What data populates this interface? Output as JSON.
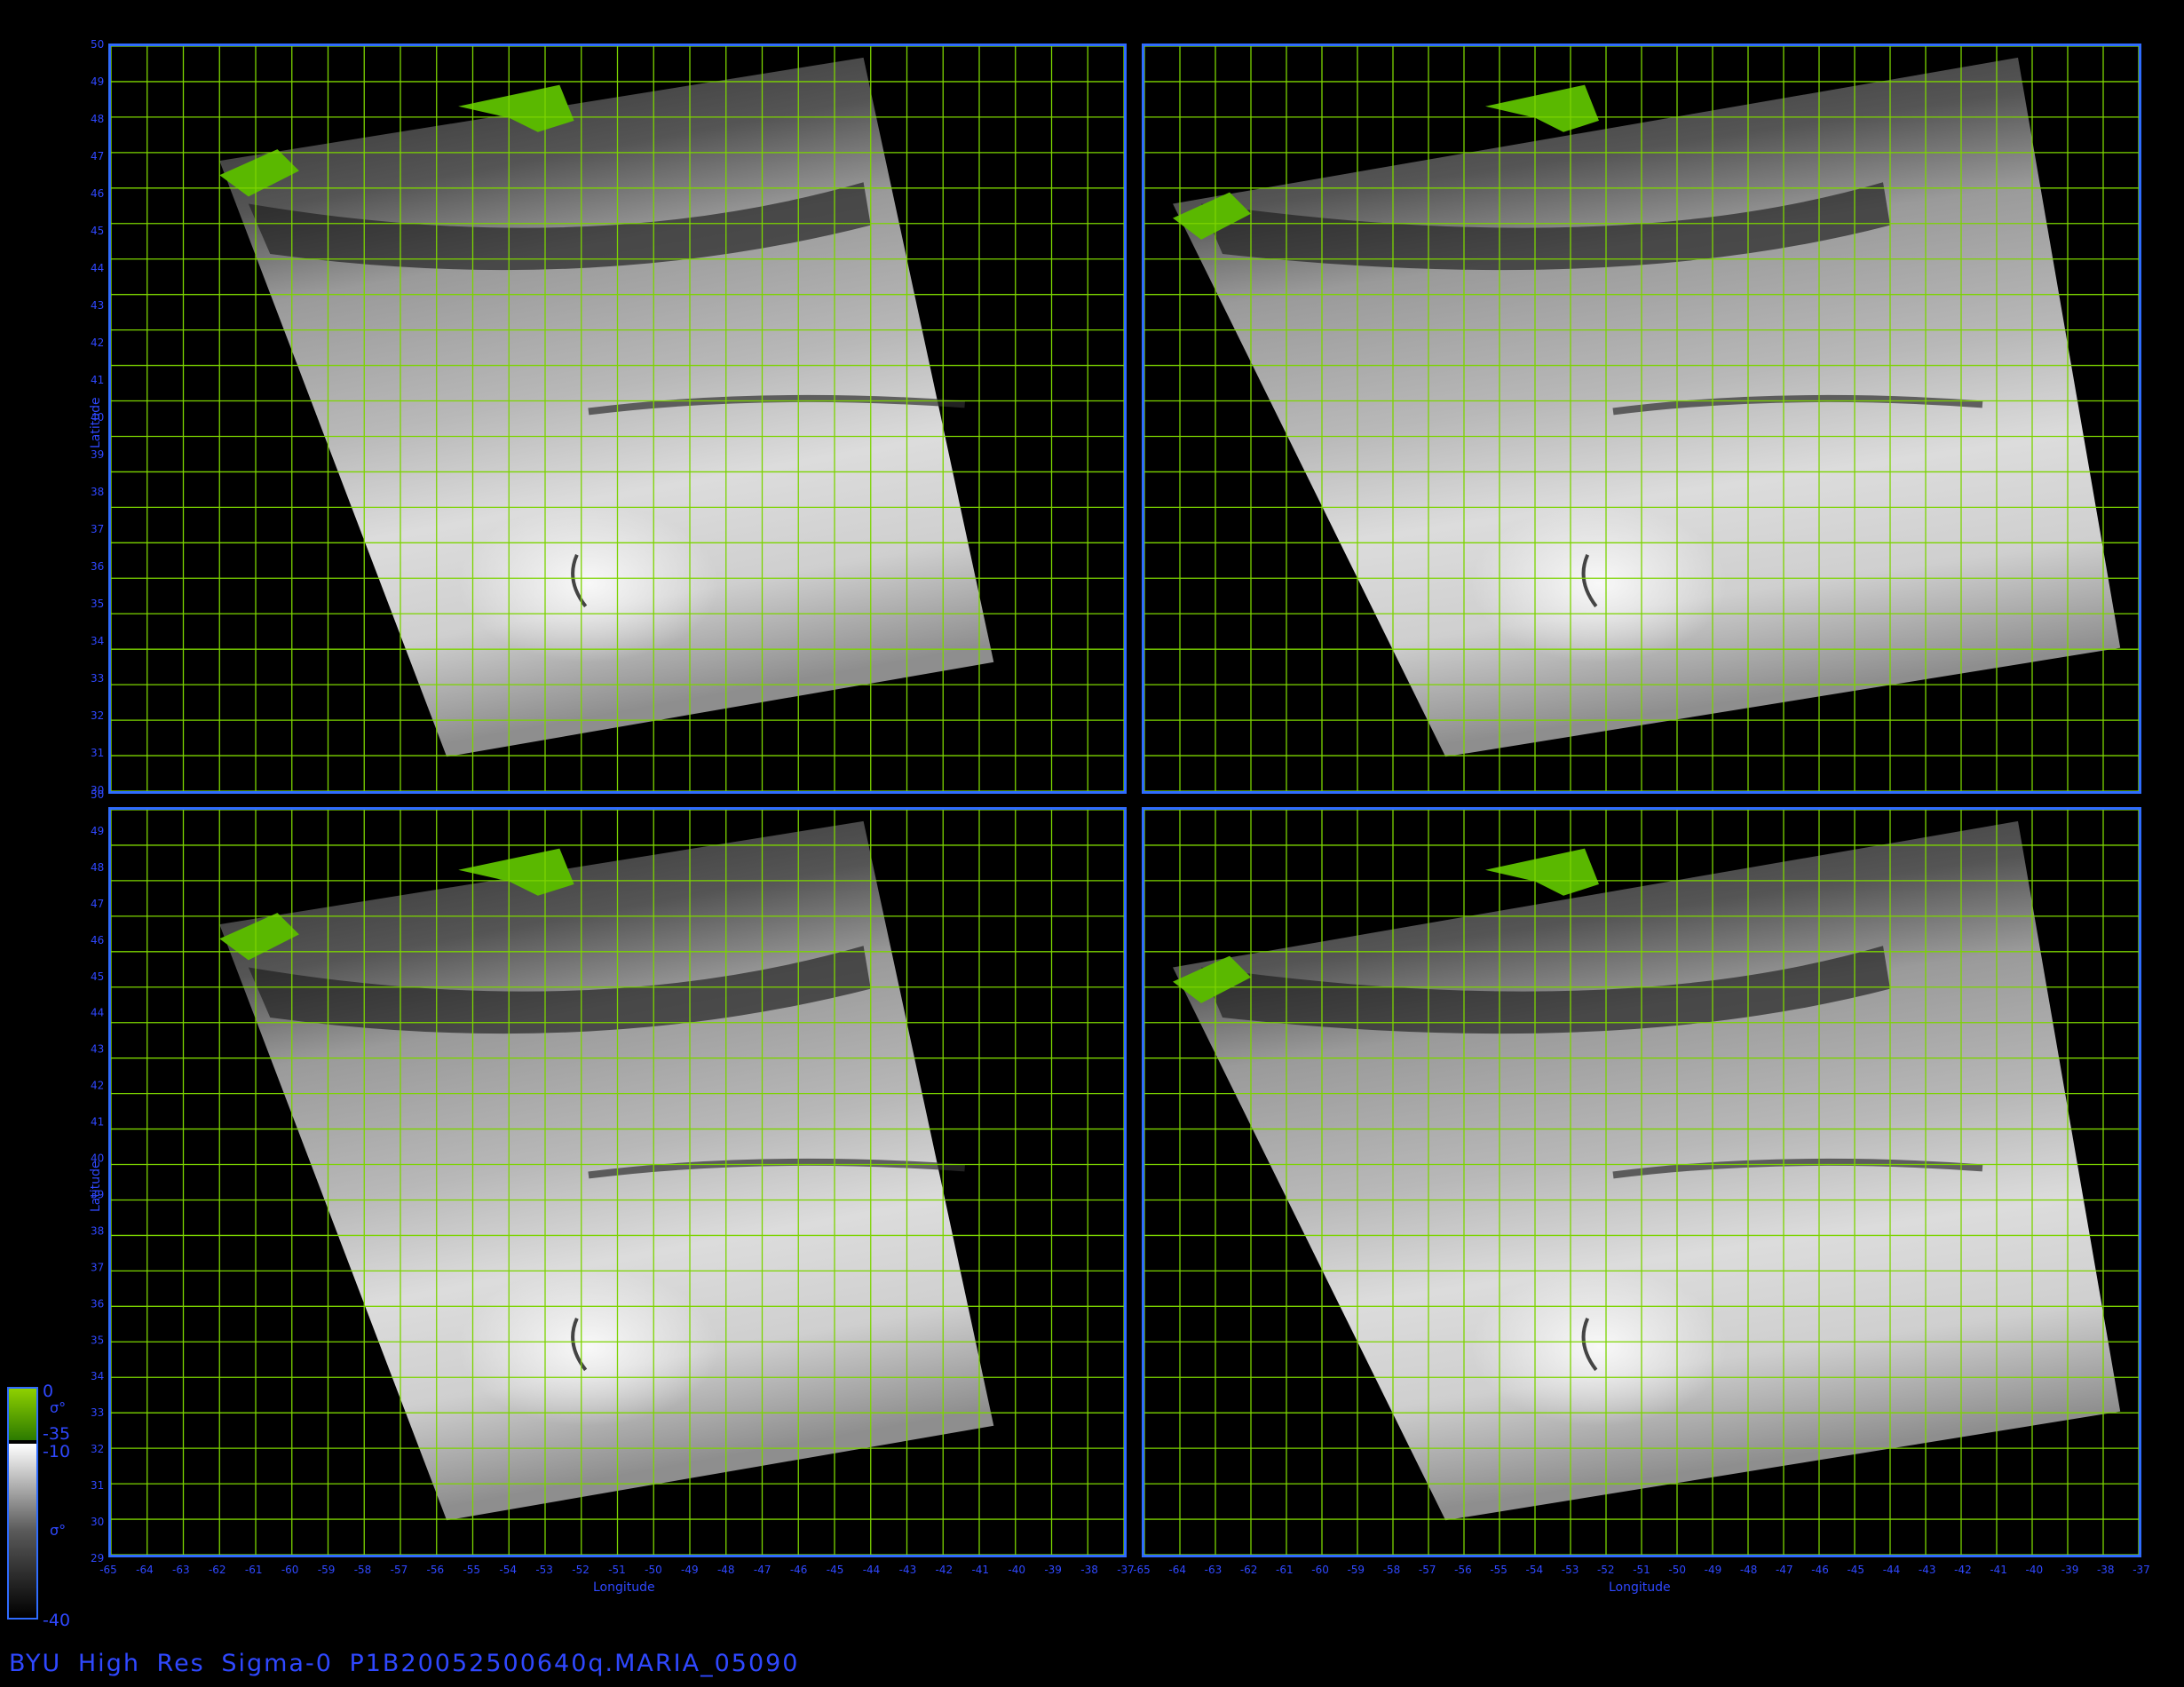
{
  "figure": {
    "footer_title": "BYU High Res Sigma-0 P1B20052500640q.MARIA_05090",
    "axis_title_y": "Latitude",
    "axis_title_x": "Longitude",
    "colors": {
      "frame": "#2f6cff",
      "grid": "#7cd400",
      "text": "#2f48ff",
      "land": "#5ab800"
    }
  },
  "colorbar": {
    "land_top_label": "0",
    "land_bottom_label": "-35",
    "land_symbol": "σ°",
    "ocean_top_label": "-10",
    "ocean_bottom_label": "-40",
    "ocean_symbol": "σ°"
  },
  "map_axes": {
    "top_row_lat_ticks": [
      "50",
      "49",
      "48",
      "47",
      "46",
      "45",
      "44",
      "43",
      "42",
      "41",
      "40",
      "39",
      "38",
      "37",
      "36",
      "35",
      "34",
      "33",
      "32",
      "31",
      "30"
    ],
    "bottom_row_lat_ticks": [
      "50/29",
      "49",
      "48",
      "47",
      "46",
      "45",
      "44",
      "43",
      "42",
      "41",
      "40",
      "39",
      "38",
      "37",
      "36",
      "35",
      "34",
      "33",
      "32",
      "31",
      "30",
      "29"
    ],
    "left_lon_ticks": [
      "-65",
      "-64",
      "-63",
      "-62",
      "-61",
      "-60",
      "-59",
      "-58",
      "-57",
      "-56",
      "-55",
      "-54",
      "-53",
      "-52",
      "-51",
      "-50",
      "-49",
      "-48",
      "-47",
      "-46",
      "-45",
      "-44",
      "-43",
      "-42",
      "-41",
      "-40",
      "-39",
      "-38",
      "-37"
    ],
    "right_lon_ticks": [
      "-65",
      "-64",
      "-63",
      "-62",
      "-61",
      "-60",
      "-59",
      "-58",
      "-57",
      "-56",
      "-55",
      "-54",
      "-53",
      "-52",
      "-51",
      "-50",
      "-49",
      "-48",
      "-47",
      "-46",
      "-45",
      "-44",
      "-43",
      "-42",
      "-41",
      "-40",
      "-39",
      "-38",
      "-37"
    ]
  },
  "panels": [
    {
      "id": "top-left",
      "swath": "narrow"
    },
    {
      "id": "top-right",
      "swath": "wide"
    },
    {
      "id": "bottom-left",
      "swath": "narrow"
    },
    {
      "id": "bottom-right",
      "swath": "wide"
    }
  ]
}
